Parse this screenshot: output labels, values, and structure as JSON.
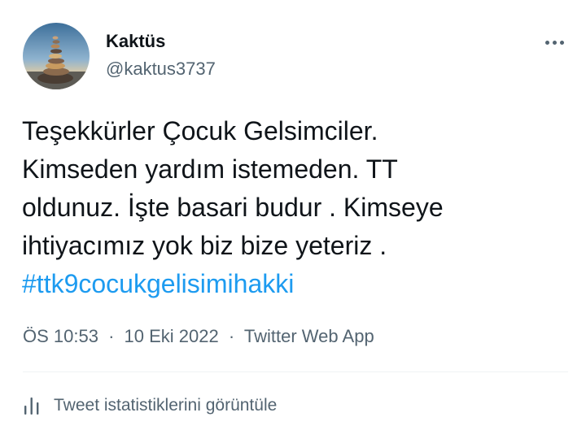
{
  "author": {
    "display_name": "Kaktüs",
    "handle": "@kaktus3737"
  },
  "icons": {
    "more": "more-options-icon",
    "analytics": "analytics-bars-icon"
  },
  "tweet": {
    "text_lines": [
      "Teşekkürler Çocuk Gelsimciler.",
      "Kimseden yardım istemeden. TT",
      "oldunuz. İşte basari budur . Kimseye",
      "ihtiyacımız yok biz bize yeteriz ."
    ],
    "hashtag": "#ttk9cocukgelisimihakki"
  },
  "meta": {
    "time": "ÖS 10:53",
    "separator": "·",
    "date": "10 Eki 2022",
    "source": "Twitter Web App"
  },
  "analytics": {
    "label": "Tweet istatistiklerini görüntüle"
  },
  "colors": {
    "link": "#1d9bf0",
    "secondary_text": "#536471",
    "primary_text": "#0f1419",
    "divider": "#eff3f4"
  }
}
